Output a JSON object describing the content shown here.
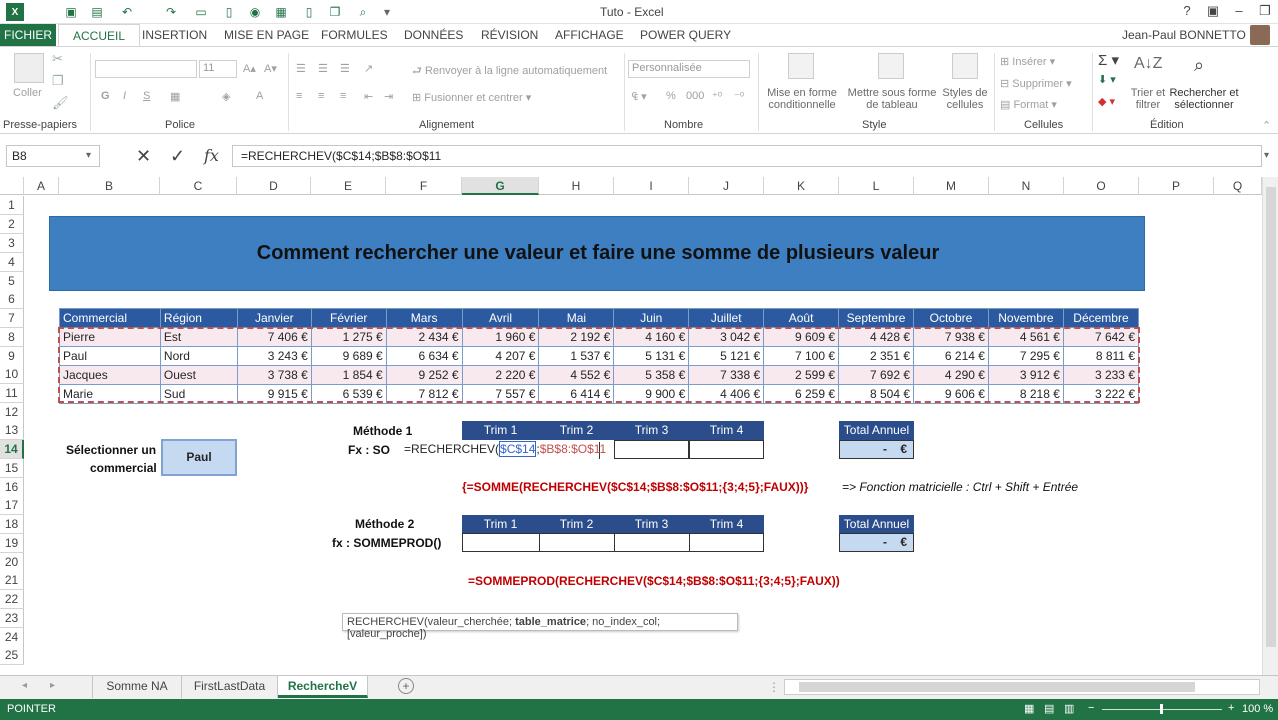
{
  "window": {
    "title": "Tuto - Excel",
    "user": "Jean-Paul BONNETTO"
  },
  "menu": {
    "fichier": "FICHIER",
    "tabs": [
      "ACCUEIL",
      "INSERTION",
      "MISE EN PAGE",
      "FORMULES",
      "DONNÉES",
      "RÉVISION",
      "AFFICHAGE",
      "POWER QUERY"
    ]
  },
  "ribbon": {
    "coller": "Coller",
    "presse": "Presse-papiers",
    "police": "Police",
    "font_size": "11",
    "bold": "G",
    "italic": "I",
    "underline": "S",
    "wrap": "Renvoyer à la ligne automatiquement",
    "merge": "Fusionner et centrer",
    "alignement": "Alignement",
    "number_format": "Personnalisée",
    "nombre": "Nombre",
    "mef1": "Mise en forme",
    "mef2": "conditionnelle",
    "mst1": "Mettre sous forme",
    "mst2": "de tableau",
    "sty1": "Styles de",
    "sty2": "cellules",
    "style": "Style",
    "inserer": "Insérer",
    "supprimer": "Supprimer",
    "format": "Format",
    "cellules": "Cellules",
    "trier1": "Trier et",
    "trier2": "filtrer",
    "rech1": "Rechercher et",
    "rech2": "sélectionner",
    "edition": "Édition"
  },
  "formula_bar": {
    "namebox": "B8",
    "fx": "fx",
    "formula": "=RECHERCHEV($C$14;$B$8:$O$11"
  },
  "columns": [
    "A",
    "B",
    "C",
    "D",
    "E",
    "F",
    "G",
    "H",
    "I",
    "J",
    "K",
    "L",
    "M",
    "N",
    "O",
    "P",
    "Q"
  ],
  "rows": [
    "1",
    "2",
    "3",
    "4",
    "5",
    "6",
    "7",
    "8",
    "9",
    "10",
    "11",
    "12",
    "13",
    "14",
    "15",
    "16",
    "17",
    "18",
    "19",
    "20",
    "21",
    "22",
    "23",
    "24",
    "25"
  ],
  "banner": "Comment rechercher une valeur et faire une somme de plusieurs valeur",
  "table": {
    "headers": [
      "Commercial",
      "Région",
      "Janvier",
      "Février",
      "Mars",
      "Avril",
      "Mai",
      "Juin",
      "Juillet",
      "Août",
      "Septembre",
      "Octobre",
      "Novembre",
      "Décembre"
    ],
    "rows": [
      [
        "Pierre",
        "Est",
        "7 406 €",
        "1 275 €",
        "2 434 €",
        "1 960 €",
        "2 192 €",
        "4 160 €",
        "3 042 €",
        "9 609 €",
        "4 428 €",
        "7 938 €",
        "4 561 €",
        "7 642 €"
      ],
      [
        "Paul",
        "Nord",
        "3 243 €",
        "9 689 €",
        "6 634 €",
        "4 207 €",
        "1 537 €",
        "5 131 €",
        "5 121 €",
        "7 100 €",
        "2 351 €",
        "6 214 €",
        "7 295 €",
        "8 811 €"
      ],
      [
        "Jacques",
        "Ouest",
        "3 738 €",
        "1 854 €",
        "9 252 €",
        "2 220 €",
        "4 552 €",
        "5 358 €",
        "7 338 €",
        "2 599 €",
        "7 692 €",
        "4 290 €",
        "3 912 €",
        "3 233 €"
      ],
      [
        "Marie",
        "Sud",
        "9 915 €",
        "6 539 €",
        "7 812 €",
        "7 557 €",
        "6 414 €",
        "9 900 €",
        "4 406 €",
        "6 259 €",
        "8 504 €",
        "9 606 €",
        "8 218 €",
        "3 222 €"
      ]
    ]
  },
  "select": {
    "label1": "Sélectionner un",
    "label2": "commercial",
    "value": "Paul"
  },
  "m1": {
    "title": "Méthode 1",
    "fx": "Fx : SO",
    "formula_prefix": "=RECHERCHEV(",
    "formula_c14": "$C$14",
    "formula_sep": ";",
    "formula_range": "$B$8:$O$11",
    "trims": [
      "Trim 1",
      "Trim 2",
      "Trim 3",
      "Trim 4"
    ],
    "total_label": "Total Annuel",
    "total_value": "-    €"
  },
  "array_formula": "{=SOMME(RECHERCHEV($C$14;$B$8:$O$11;{3;4;5};FAUX))}",
  "array_note": "=> Fonction matricielle :  Ctrl + Shift + Entrée",
  "m2": {
    "title": "Méthode 2",
    "fx": "fx : SOMMEPROD()",
    "trims": [
      "Trim 1",
      "Trim 2",
      "Trim 3",
      "Trim 4"
    ],
    "total_label": "Total Annuel",
    "total_value": "-    €"
  },
  "sommeprod": "=SOMMEPROD(RECHERCHEV($C$14;$B$8:$O$11;{3;4;5};FAUX))",
  "tooltip": {
    "a": "RECHERCHEV(valeur_cherchée; ",
    "b": "table_matrice",
    "c": "; no_index_col; [valeur_proche])"
  },
  "sheets": [
    "Somme NA",
    "FirstLastData",
    "RechercheV"
  ],
  "status": {
    "mode": "POINTER",
    "zoom": "100 %"
  },
  "colors": {
    "excel_green": "#217346",
    "banner": "#3e7fc1",
    "header": "#2c5aa0",
    "formula_red": "#c00000"
  }
}
